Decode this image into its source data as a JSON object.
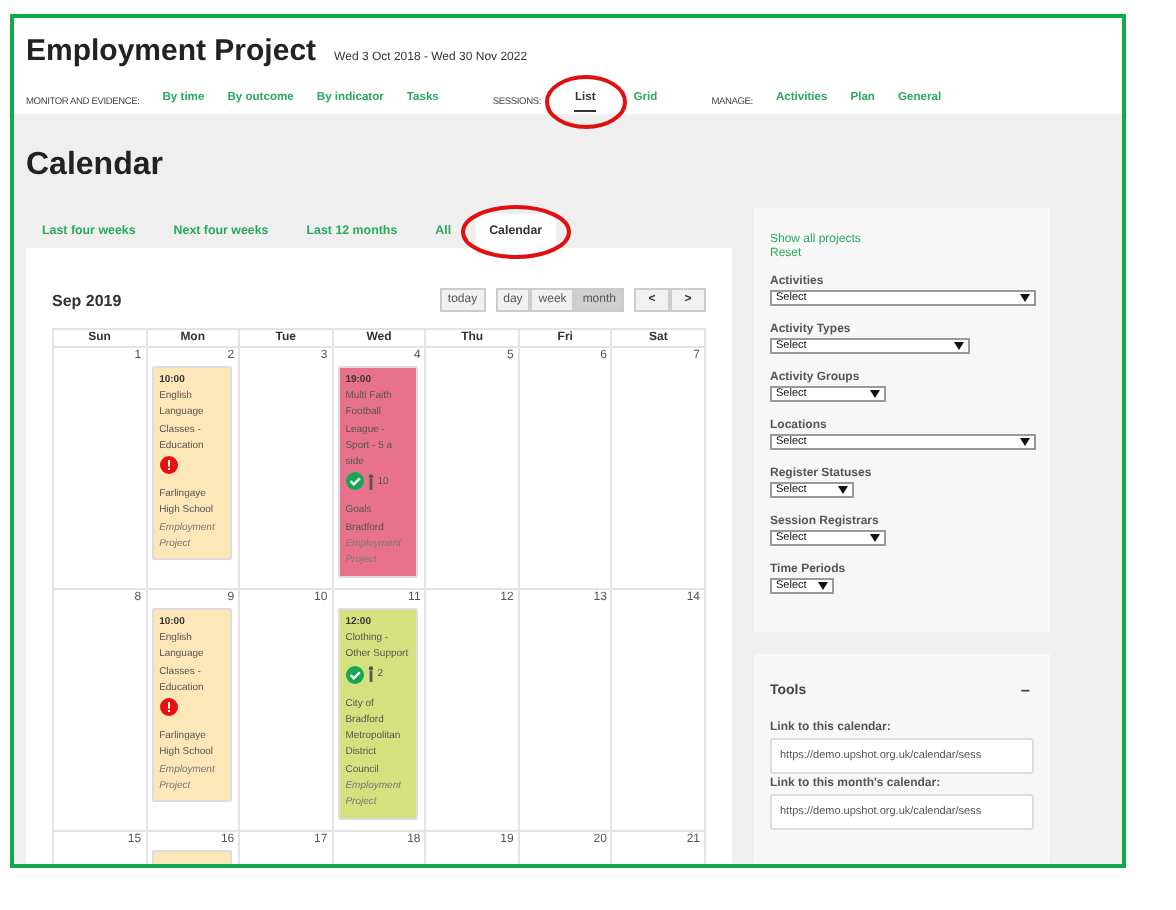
{
  "header": {
    "title": "Employment Project",
    "dates": "Wed 3 Oct 2018 - Wed 30 Nov 2022"
  },
  "nav": [
    {
      "label": "MONITOR AND EVIDENCE:",
      "links": [
        {
          "label": "By time",
          "selected": false
        },
        {
          "label": "By outcome",
          "selected": false
        },
        {
          "label": "By indicator",
          "selected": false
        },
        {
          "label": "Tasks",
          "selected": false
        }
      ]
    },
    {
      "label": "SESSIONS:",
      "links": [
        {
          "label": "List",
          "selected": true
        },
        {
          "label": "Grid",
          "selected": false
        }
      ]
    },
    {
      "label": "MANAGE:",
      "links": [
        {
          "label": "Activities",
          "selected": false
        },
        {
          "label": "Plan",
          "selected": false
        },
        {
          "label": "General",
          "selected": false
        }
      ]
    }
  ],
  "page_title": "Calendar",
  "tabs": [
    {
      "label": "Last four weeks",
      "selected": false
    },
    {
      "label": "Next four weeks",
      "selected": false
    },
    {
      "label": "Last 12 months",
      "selected": false
    },
    {
      "label": "All",
      "selected": false
    },
    {
      "label": "Calendar",
      "selected": true
    }
  ],
  "calendar": {
    "title": "Sep 2019",
    "today_button": "today",
    "views": [
      {
        "label": "day",
        "selected": false
      },
      {
        "label": "week",
        "selected": false
      },
      {
        "label": "month",
        "selected": true
      }
    ],
    "nav_buttons": [
      "<",
      ">"
    ],
    "weekdays": [
      "Sun",
      "Mon",
      "Tue",
      "Wed",
      "Thu",
      "Fri",
      "Sat"
    ],
    "weeks": [
      {
        "days": [
          {
            "date": "1"
          },
          {
            "date": "2",
            "events": [
              {
                "color": "#fde6b8",
                "time": "10:00",
                "title": "English Language Classes - Education",
                "kind": "alert",
                "location": "Farlingaye High School",
                "project": "Employment Project"
              }
            ]
          },
          {
            "date": "3"
          },
          {
            "date": "4",
            "events": [
              {
                "color": "#e8728b",
                "time": "19:00",
                "title": "Multi Faith Football League - Sport - 5 a side",
                "kind": "done",
                "count": "10",
                "location": "Goals Bradford",
                "project": "Employment Project"
              }
            ]
          },
          {
            "date": "5"
          },
          {
            "date": "6"
          },
          {
            "date": "7"
          }
        ]
      },
      {
        "days": [
          {
            "date": "8"
          },
          {
            "date": "9",
            "events": [
              {
                "color": "#fde6b8",
                "time": "10:00",
                "title": "English Language Classes - Education",
                "kind": "alert",
                "location": "Farlingaye High School",
                "project": "Employment Project"
              }
            ]
          },
          {
            "date": "10"
          },
          {
            "date": "11",
            "events": [
              {
                "color": "#d5e17f",
                "time": "12:00",
                "title": "Clothing - Other Support",
                "kind": "done",
                "count": "2",
                "location": "City of Bradford Metropolitan District Council",
                "project": "Employment Project"
              }
            ]
          },
          {
            "date": "12"
          },
          {
            "date": "13"
          },
          {
            "date": "14"
          }
        ]
      },
      {
        "days": [
          {
            "date": "15"
          },
          {
            "date": "16",
            "events": [
              {
                "color": "#fde6b8"
              }
            ]
          },
          {
            "date": "17"
          },
          {
            "date": "18"
          },
          {
            "date": "19"
          },
          {
            "date": "20"
          },
          {
            "date": "21"
          }
        ]
      }
    ]
  },
  "sidebar": {
    "links": [
      "Show all projects",
      "Reset"
    ],
    "filters": [
      {
        "label": "Activities",
        "value": "Select"
      },
      {
        "label": "Activity Types",
        "value": "Select"
      },
      {
        "label": "Activity Groups",
        "value": "Select"
      },
      {
        "label": "Locations",
        "value": "Select"
      },
      {
        "label": "Register Statuses",
        "value": "Select"
      },
      {
        "label": "Session Registrars",
        "value": "Select"
      },
      {
        "label": "Time Periods",
        "value": "Select"
      }
    ]
  },
  "tools": {
    "title": "Tools",
    "collapse": "−",
    "links": [
      {
        "label": "Link to this calendar:",
        "value": "https://demo.upshot.org.uk/calendar/sess"
      },
      {
        "label": "Link to this month's calendar:",
        "value": "https://demo.upshot.org.uk/calendar/sess"
      }
    ]
  }
}
